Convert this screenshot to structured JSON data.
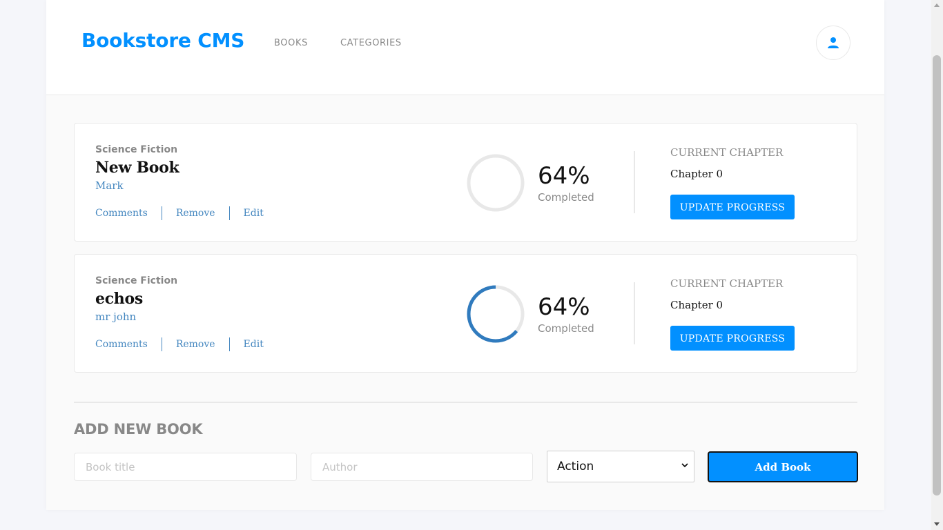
{
  "header": {
    "logo": "Bookstore CMS",
    "nav": [
      "BOOKS",
      "CATEGORIES"
    ]
  },
  "books": [
    {
      "genre": "Science Fiction",
      "title": "New Book",
      "author": "Mark",
      "actions": [
        "Comments",
        "Remove",
        "Edit"
      ],
      "percent_text": "64%",
      "progress_fraction": 0.64,
      "completed_label": "Completed",
      "current_chapter_label": "CURRENT CHAPTER",
      "chapter": "Chapter 0",
      "update_button": "UPDATE PROGRESS"
    },
    {
      "genre": "Science Fiction",
      "title": "echos",
      "author": "mr john",
      "actions": [
        "Comments",
        "Remove",
        "Edit"
      ],
      "percent_text": "64%",
      "progress_fraction": 0.64,
      "completed_label": "Completed",
      "current_chapter_label": "CURRENT CHAPTER",
      "chapter": "Chapter 0",
      "update_button": "UPDATE PROGRESS"
    }
  ],
  "add_book": {
    "heading": "ADD NEW BOOK",
    "title_placeholder": "Book title",
    "author_placeholder": "Author",
    "category_selected": "Action",
    "submit_label": "Add Book"
  },
  "colors": {
    "accent": "#0290ff",
    "progress": "#307bbe",
    "progress_track": "#e8e8e8",
    "link": "#4386bf"
  },
  "icons": {
    "user": "user-icon",
    "select_arrow": "chevron-down-icon"
  }
}
